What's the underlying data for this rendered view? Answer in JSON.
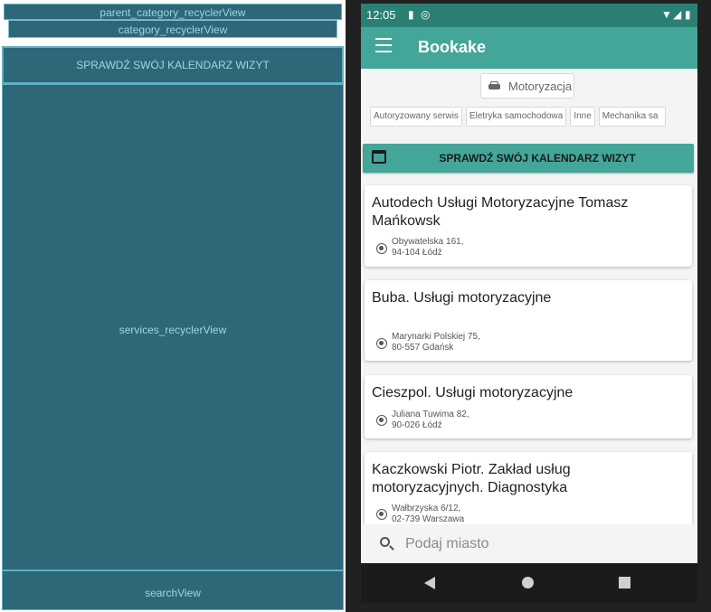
{
  "blueprint": {
    "parent_category": "parent_category_recyclerView",
    "category": "category_recyclerView",
    "calendar_button": "SPRAWDŹ SWÓJ KALENDARZ WIZYT",
    "services": "services_recyclerView",
    "search": "searchView"
  },
  "status_bar": {
    "time": "12:05"
  },
  "app_bar": {
    "title": "Bookake",
    "menu_icon": "hamburger-menu-icon"
  },
  "parent_category": {
    "label": "Motoryzacja",
    "icon": "car-icon"
  },
  "categories": [
    "Autoryzowany serwis",
    "Eletryka samochodowa",
    "Inne",
    "Mechanika sa"
  ],
  "calendar_button": {
    "label": "SPRAWDŹ SWÓJ KALENDARZ WIZYT",
    "icon": "calendar-icon"
  },
  "services": [
    {
      "name": "Autodech Usługi Motoryzacyjne Tomasz Mańkowsk",
      "address_line1": "Obywatelska 161,",
      "address_line2": "94-104 Łódź"
    },
    {
      "name": "Buba. Usługi motoryzacyjne",
      "address_line1": "Marynarki Polskiej 75,",
      "address_line2": "80-557 Gdańsk"
    },
    {
      "name": "Cieszpol. Usługi motoryzacyjne",
      "address_line1": "Juliana Tuwima 82,",
      "address_line2": "90-026 Łódź"
    },
    {
      "name": "Kaczkowski Piotr. Zakład usług motoryzacyjnych. Diagnostyka",
      "address_line1": "Wałbrzyska 6/12,",
      "address_line2": "02-739 Warszawa"
    }
  ],
  "search": {
    "placeholder": "Podaj miasto",
    "icon": "search-icon"
  },
  "colors": {
    "primary": "#43a699",
    "primary_dark": "#2a8073",
    "blueprint": "#2d6778"
  }
}
